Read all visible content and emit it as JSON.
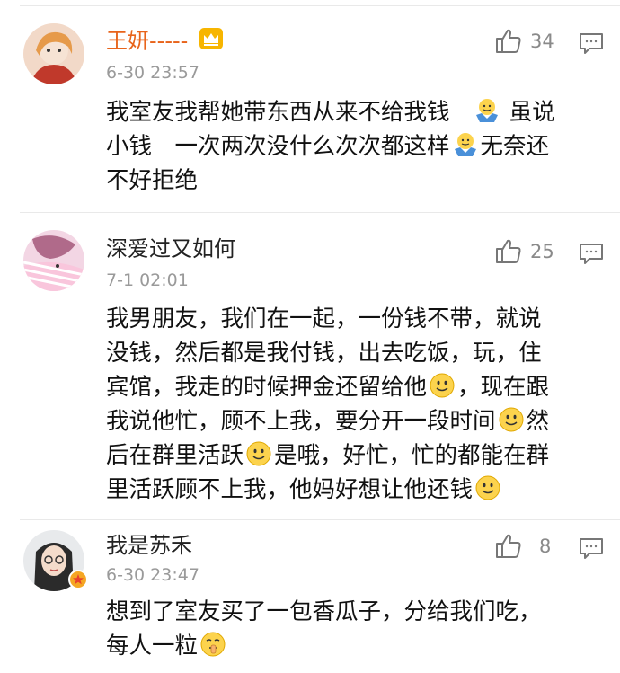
{
  "comments": [
    {
      "username": "王妍-----",
      "badge": "crown-badge-icon",
      "timestamp": "6-30 23:57",
      "likes": "34",
      "username_color": "#e8641b",
      "lines": [
        [
          "我室友我帮她带东西从来不给我钱",
          "虽说"
        ],
        [
          "小钱　一次两次没什么次次都这样",
          "无奈还"
        ],
        [
          "不好拒绝"
        ]
      ]
    },
    {
      "username": "深爱过又如何",
      "timestamp": "7-1 02:01",
      "likes": "25",
      "lines": [
        [
          "我男朋友，我们在一起，一份钱不带，就说"
        ],
        [
          "没钱，然后都是我付钱，出去吃饭，玩，住"
        ],
        [
          "宾馆，我走的时候押金还留给他",
          "，现在跟"
        ],
        [
          "我说他忙，顾不上我，要分开一段时间",
          "然"
        ],
        [
          "后在群里活跃",
          "是哦，好忙，忙的都能在群"
        ],
        [
          "里活跃顾不上我，他妈好想让他还钱"
        ]
      ]
    },
    {
      "username": "我是苏禾",
      "timestamp": "6-30 23:47",
      "likes": "8",
      "lines": [
        [
          "想到了室友买了一包香瓜子，分给我们吃，"
        ],
        [
          "每人一粒"
        ]
      ]
    }
  ]
}
